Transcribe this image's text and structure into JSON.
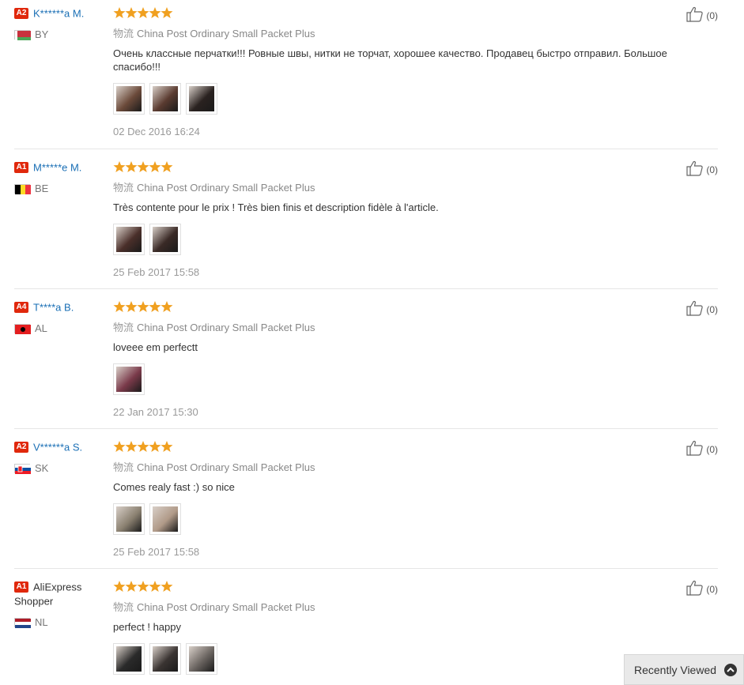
{
  "reviews": [
    {
      "level": "A2",
      "name": "K******a M.",
      "name_plain": false,
      "country": "BY",
      "flag": "by",
      "logistics_label": "物流",
      "logistics": "China Post Ordinary Small Packet Plus",
      "text": "Очень классные перчатки!!! Ровные швы, нитки не торчат, хорошее качество. Продавец быстро отправил. Большое спасибо!!!",
      "photos": [
        "#6b4a3a",
        "#5a3b30",
        "#2a2220"
      ],
      "date": "02 Dec 2016 16:24",
      "useful": "(0)"
    },
    {
      "level": "A1",
      "name": "M*****e M.",
      "name_plain": false,
      "country": "BE",
      "flag": "be",
      "logistics_label": "物流",
      "logistics": "China Post Ordinary Small Packet Plus",
      "text": "Très contente pour le prix ! Très bien finis et description fidèle à l'article.",
      "photos": [
        "#4a2f2a",
        "#3a2a26"
      ],
      "date": "25 Feb 2017 15:58",
      "useful": "(0)"
    },
    {
      "level": "A4",
      "name": "T****a B.",
      "name_plain": false,
      "country": "AL",
      "flag": "al",
      "logistics_label": "物流",
      "logistics": "China Post Ordinary Small Packet Plus",
      "text": "loveee em perfectt",
      "photos": [
        "#7a3a4a"
      ],
      "date": "22 Jan 2017 15:30",
      "useful": "(0)"
    },
    {
      "level": "A2",
      "name": "V******a S.",
      "name_plain": false,
      "country": "SK",
      "flag": "sk",
      "logistics_label": "物流",
      "logistics": "China Post Ordinary Small Packet Plus",
      "text": "Comes realy fast :) so nice",
      "photos": [
        "#8a8070",
        "#b09a88"
      ],
      "date": "25 Feb 2017 15:58",
      "useful": "(0)"
    },
    {
      "level": "A1",
      "name": "AliExpress Shopper",
      "name_plain": true,
      "country": "NL",
      "flag": "nl",
      "logistics_label": "物流",
      "logistics": "China Post Ordinary Small Packet Plus",
      "text": "perfect ! happy",
      "photos": [
        "#2a2a2a",
        "#3a3432",
        "#6a6460"
      ],
      "date": "",
      "useful": "(0)"
    }
  ],
  "recently_viewed": "Recently Viewed",
  "colors": {
    "star": "#f0a020",
    "name_link": "#1a6fb5",
    "level_badge": "#e0280c"
  }
}
